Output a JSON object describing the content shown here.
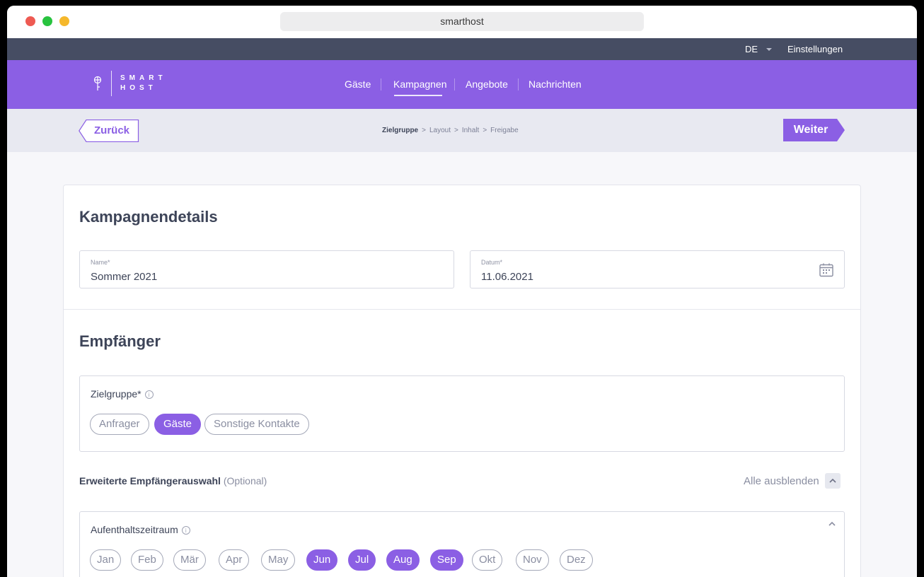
{
  "browser": {
    "url": "smarthost"
  },
  "topbar": {
    "language": "DE",
    "settings": "Einstellungen"
  },
  "logo": {
    "line1": "SMART",
    "line2": "HOST"
  },
  "nav": {
    "items": [
      {
        "label": "Gäste"
      },
      {
        "label": "Kampagnen",
        "active": true
      },
      {
        "label": "Angebote"
      },
      {
        "label": "Nachrichten"
      }
    ]
  },
  "steps": {
    "back": "Zurück",
    "next": "Weiter",
    "crumbs": [
      "Zielgruppe",
      "Layout",
      "Inhalt",
      "Freigabe"
    ],
    "separator": ">"
  },
  "details": {
    "title": "Kampagnendetails",
    "name_label": "Name*",
    "name_value": "Sommer 2021",
    "date_label": "Datum*",
    "date_value": "11.06.2021"
  },
  "recipients": {
    "title": "Empfänger",
    "target_label": "Zielgruppe*",
    "target_chips": [
      {
        "label": "Anfrager",
        "selected": false
      },
      {
        "label": "Gäste",
        "selected": true
      },
      {
        "label": "Sonstige Kontakte",
        "selected": false
      }
    ],
    "advanced_label": "Erweiterte Empfängerauswahl",
    "advanced_optional": "(Optional)",
    "hide_all": "Alle ausblenden",
    "stay_label": "Aufenthaltszeitraum",
    "months": [
      {
        "label": "Jan",
        "selected": false
      },
      {
        "label": "Feb",
        "selected": false
      },
      {
        "label": "Mär",
        "selected": false
      },
      {
        "label": "Apr",
        "selected": false
      },
      {
        "label": "May",
        "selected": false
      },
      {
        "label": "Jun",
        "selected": true
      },
      {
        "label": "Jul",
        "selected": true
      },
      {
        "label": "Aug",
        "selected": true
      },
      {
        "label": "Sep",
        "selected": true
      },
      {
        "label": "Okt",
        "selected": false
      },
      {
        "label": "Nov",
        "selected": false
      },
      {
        "label": "Dez",
        "selected": false
      }
    ]
  },
  "colors": {
    "accent": "#8b5fe4",
    "topstrip": "#464d63",
    "text": "#3d4458"
  }
}
